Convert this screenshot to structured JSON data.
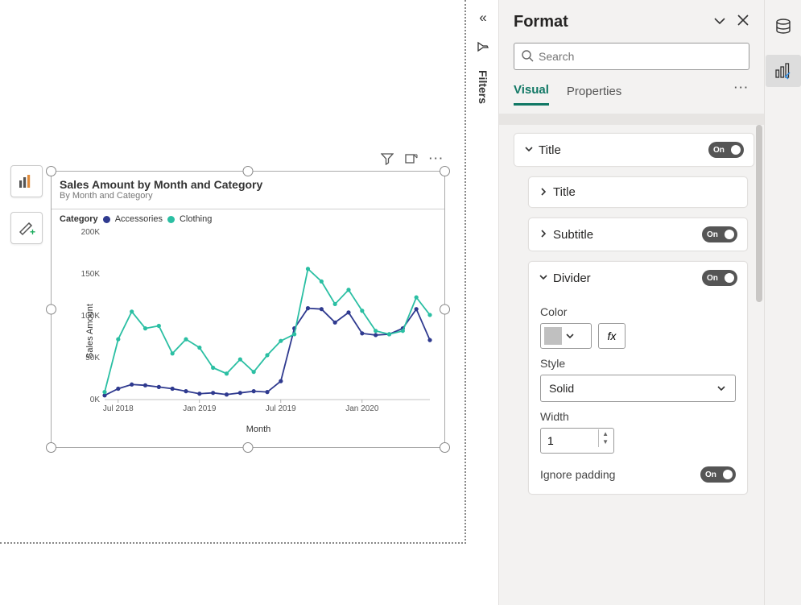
{
  "filters": {
    "label": "Filters"
  },
  "visual": {
    "title": "Sales Amount by Month and Category",
    "subtitle": "By Month and Category",
    "legend_title": "Category",
    "y_axis": "Sales Amount",
    "x_axis": "Month",
    "legend_items": [
      {
        "label": "Accessories",
        "color": "#2f3a8f"
      },
      {
        "label": "Clothing",
        "color": "#2bbfa3"
      }
    ]
  },
  "chart_data": {
    "type": "line",
    "xlabel": "Month",
    "ylabel": "Sales Amount",
    "title": "Sales Amount by Month and Category",
    "ylim": [
      0,
      200000
    ],
    "y_ticks_display": [
      "0K",
      "50K",
      "100K",
      "150K",
      "200K"
    ],
    "x_tick_labels": [
      "Jul 2018",
      "Jan 2019",
      "Jul 2019",
      "Jan 2020"
    ],
    "x": [
      "2018-06",
      "2018-07",
      "2018-08",
      "2018-09",
      "2018-10",
      "2018-11",
      "2018-12",
      "2019-01",
      "2019-02",
      "2019-03",
      "2019-04",
      "2019-05",
      "2019-06",
      "2019-07",
      "2019-08",
      "2019-09",
      "2019-10",
      "2019-11",
      "2019-12",
      "2020-01",
      "2020-02",
      "2020-03",
      "2020-04",
      "2020-05",
      "2020-06"
    ],
    "series": [
      {
        "name": "Accessories",
        "color": "#2f3a8f",
        "values": [
          5000,
          13000,
          18000,
          17000,
          15000,
          13000,
          10000,
          7000,
          8000,
          6000,
          8000,
          10000,
          9000,
          22000,
          85000,
          109000,
          108000,
          92000,
          104000,
          79000,
          77000,
          78000,
          85000,
          108000,
          71000
        ]
      },
      {
        "name": "Clothing",
        "color": "#2bbfa3",
        "values": [
          9000,
          72000,
          105000,
          85000,
          88000,
          55000,
          72000,
          62000,
          38000,
          31000,
          48000,
          33000,
          53000,
          70000,
          78000,
          156000,
          141000,
          114000,
          131000,
          106000,
          82000,
          78000,
          82000,
          122000,
          101000
        ]
      }
    ]
  },
  "panel": {
    "title": "Format",
    "search_placeholder": "Search",
    "tabs": {
      "visual": "Visual",
      "properties": "Properties"
    },
    "sections": {
      "title_section": {
        "label": "Title",
        "state": "On"
      },
      "title_inner": {
        "label": "Title"
      },
      "subtitle": {
        "label": "Subtitle",
        "state": "On"
      },
      "divider": {
        "label": "Divider",
        "state": "On"
      },
      "ignore_padding": {
        "label": "Ignore padding",
        "state": "On"
      }
    },
    "divider_fields": {
      "color_label": "Color",
      "color_value": "#c0c0c0",
      "fx": "fx",
      "style_label": "Style",
      "style_value": "Solid",
      "width_label": "Width",
      "width_value": "1"
    }
  }
}
